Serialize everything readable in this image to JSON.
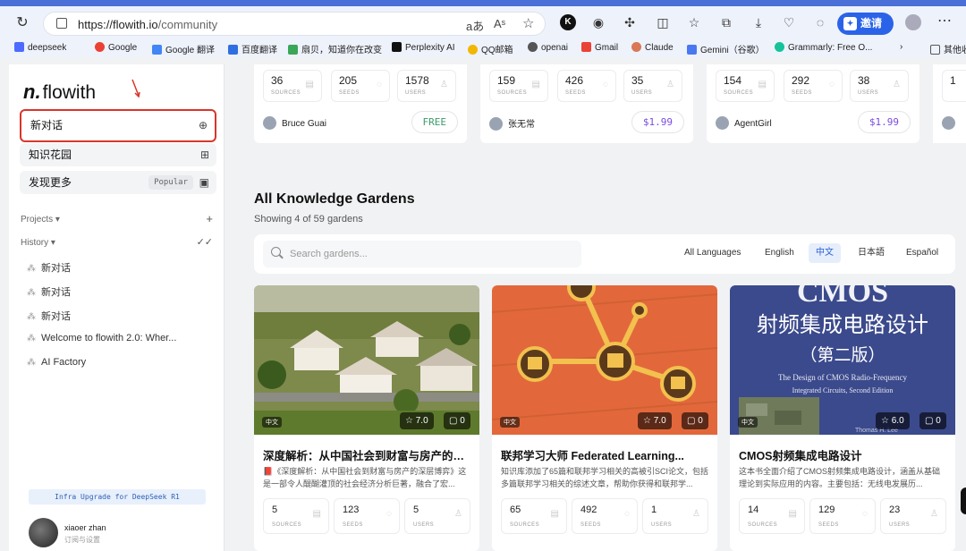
{
  "browser": {
    "url_host": "https://flowith.io",
    "url_path": "/community",
    "invite_label": "邀请",
    "bookmarks": [
      "deepseek",
      "Google",
      "Google 翻译",
      "百度翻译",
      "扇贝，知道你在改变",
      "Perplexity AI",
      "QQ邮箱",
      "openai",
      "Gmail",
      "Claude",
      "Gemini（谷歌）",
      "Grammarly: Free O...",
      "其他收"
    ]
  },
  "colors": {
    "accent": "#2b63e8",
    "selection_border": "#d9352b",
    "free": "#3b9b6a",
    "paid": "#7a4be0"
  },
  "sidebar": {
    "logo": "flowith",
    "items": [
      {
        "label": "新对话",
        "icon": "new-chat-icon"
      },
      {
        "label": "知识花园",
        "icon": "garden-icon"
      },
      {
        "label": "发现更多",
        "badge": "Popular",
        "icon": "bag-icon"
      }
    ],
    "projects_label": "Projects ▾",
    "history_label": "History ▾",
    "history": [
      "新对话",
      "新对话",
      "新对话",
      "Welcome to flowith 2.0: Wher...",
      "AI Factory"
    ],
    "upgrade": "Infra Upgrade for DeepSeek R1",
    "user_name": "xiaoer zhan",
    "user_sub": "订阅与设置"
  },
  "top_cards": [
    {
      "sources": "36",
      "seeds": "205",
      "users": "1578",
      "author": "Bruce Guai",
      "price": "FREE"
    },
    {
      "sources": "159",
      "seeds": "426",
      "users": "35",
      "author": "张无常",
      "price": "$1.99"
    },
    {
      "sources": "154",
      "seeds": "292",
      "users": "38",
      "author": "AgentGirl",
      "price": "$1.99"
    },
    {
      "sources": "1",
      "seeds": "",
      "users": "",
      "author": "",
      "price": ""
    }
  ],
  "labels": {
    "sources": "SOURCES",
    "seeds": "SEEDS",
    "users": "USERS"
  },
  "main": {
    "title": "All Knowledge Gardens",
    "subtitle": "Showing 4 of 59 gardens",
    "search_placeholder": "Search gardens...",
    "languages": [
      "All Languages",
      "English",
      "中文",
      "日本語",
      "Español"
    ]
  },
  "gardens": [
    {
      "lang": "中文",
      "rating": "☆ 7.0",
      "comments": "▢ 0",
      "title": "深度解析：从中国社会到财富与房产的深...",
      "desc": "📕《深度解析：从中国社会到财富与房产的深层博弈》这是一部令人醍醐灌顶的社会经济分析巨著，融合了宏...",
      "sources": "5",
      "seeds": "123",
      "users": "5"
    },
    {
      "lang": "中文",
      "rating": "☆ 7.0",
      "comments": "▢ 0",
      "title": "联邦学习大师 Federated Learning...",
      "desc": "知识库添加了65篇和联邦学习相关的高被引SCI论文，包括多篇联邦学习相关的综述文章，帮助你获得和联邦学...",
      "sources": "65",
      "seeds": "492",
      "users": "1"
    },
    {
      "lang": "中文",
      "rating": "☆ 6.0",
      "comments": "▢ 0",
      "title": "CMOS射频集成电路设计",
      "desc": "这本书全面介绍了CMOS射频集成电路设计，涵盖从基础理论到实际应用的内容。主要包括：无线电发展历...",
      "sources": "14",
      "seeds": "129",
      "users": "23"
    }
  ],
  "cmos_cover": {
    "line1": "CMOS",
    "line2": "射频集成电路设计",
    "line3": "（第二版）",
    "line4": "The Design of CMOS Radio-Frequency",
    "line5": "Integrated Circuits, Second Edition",
    "line6": "Thomas H. Lee"
  }
}
